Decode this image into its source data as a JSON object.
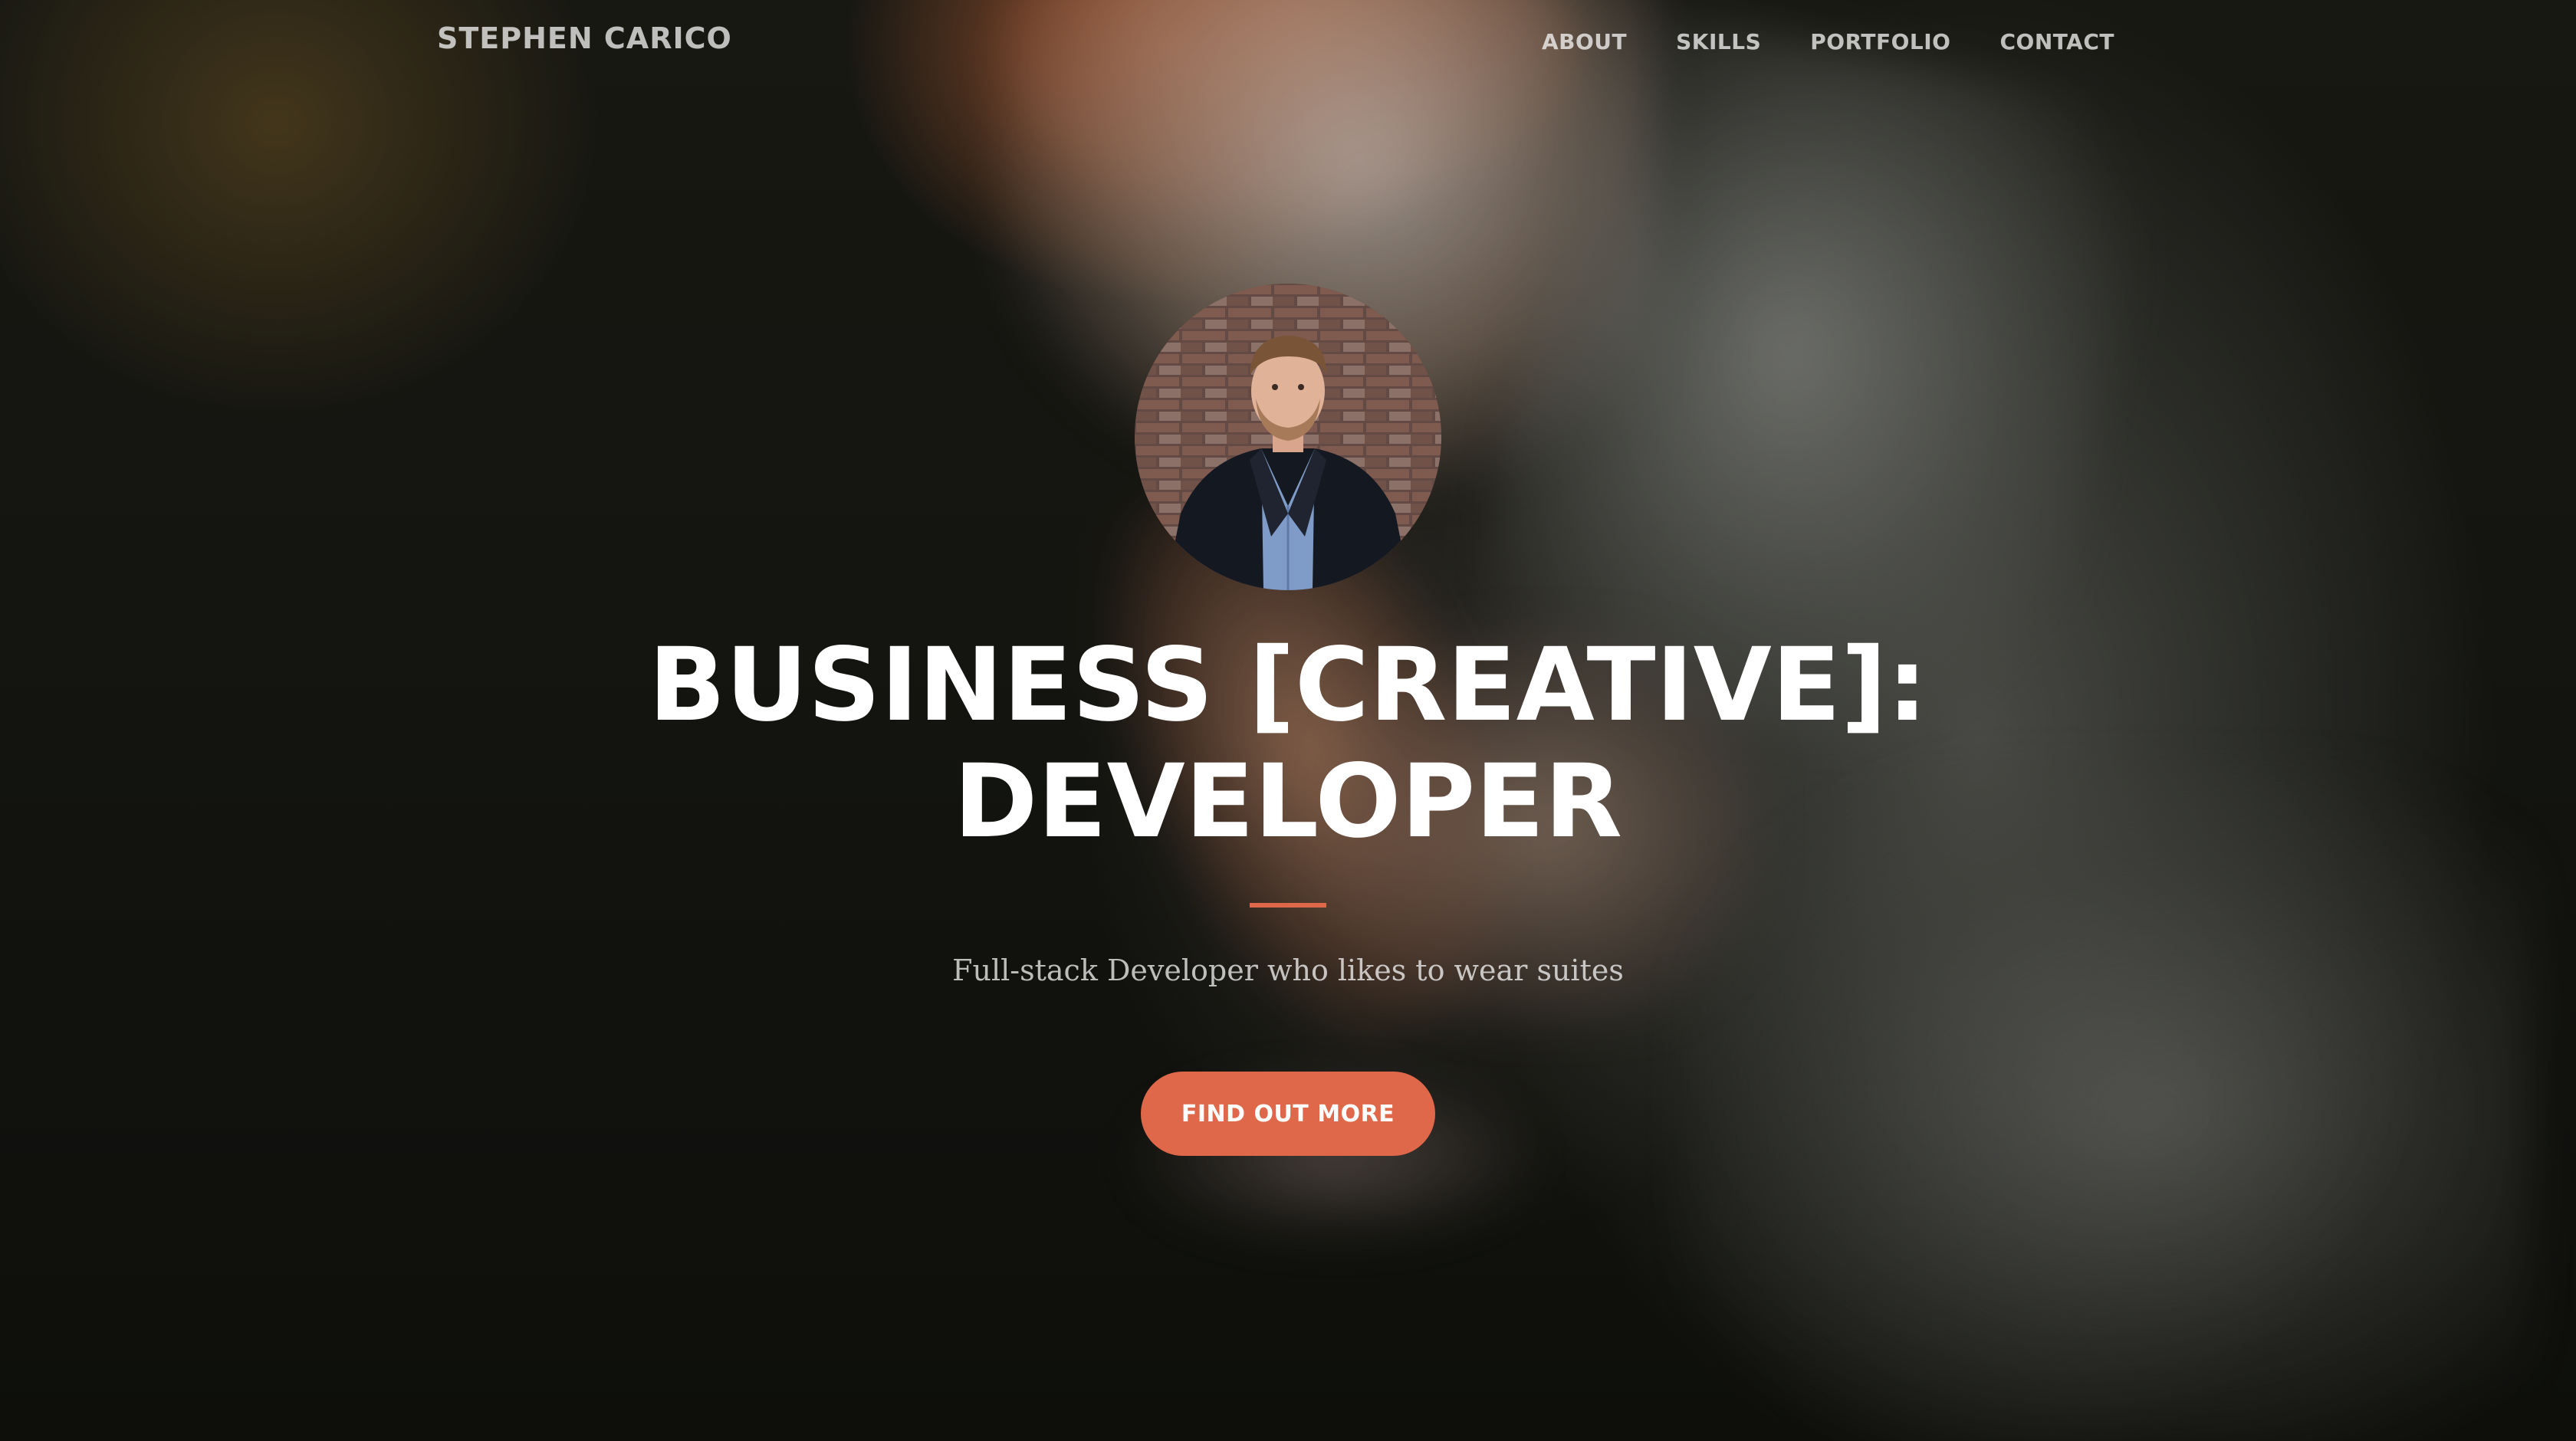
{
  "nav": {
    "brand": "STEPHEN CARICO",
    "links": [
      {
        "label": "ABOUT"
      },
      {
        "label": "SKILLS"
      },
      {
        "label": "PORTFOLIO"
      },
      {
        "label": "CONTACT"
      }
    ]
  },
  "hero": {
    "headline_line1": "BUSINESS [CREATIVE]:",
    "headline_line2": "DEVELOPER",
    "subtitle": "Full-stack Developer who likes to wear suites",
    "cta_label": "FIND OUT MORE"
  },
  "colors": {
    "accent": "#e0684a",
    "text": "#ffffff",
    "nav_text": "rgba(255,255,255,0.72)"
  }
}
